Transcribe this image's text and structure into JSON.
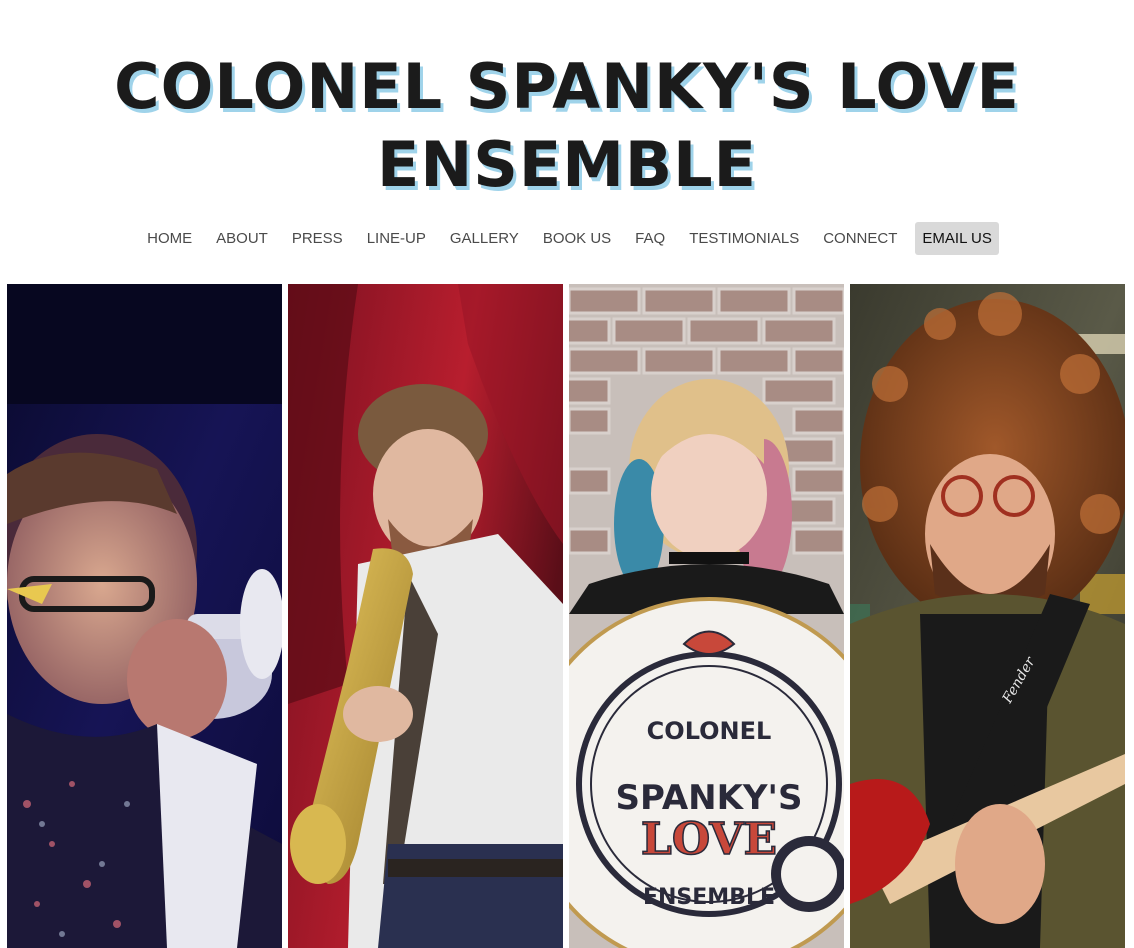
{
  "header": {
    "title_line1": "COLONEL SPANKY'S LOVE",
    "title_line2": "ENSEMBLE"
  },
  "nav": {
    "items": [
      {
        "label": "HOME"
      },
      {
        "label": "ABOUT"
      },
      {
        "label": "PRESS"
      },
      {
        "label": "LINE-UP"
      },
      {
        "label": "GALLERY"
      },
      {
        "label": "BOOK US"
      },
      {
        "label": "FAQ"
      },
      {
        "label": "TESTIMONIALS"
      },
      {
        "label": "CONNECT"
      }
    ],
    "cta_label": "EMAIL US"
  },
  "gallery": {
    "drum_logo": {
      "top": "COLONEL",
      "middle": "SPANKY'S",
      "love": "LOVE",
      "bottom": "ENSEMBLE"
    },
    "guitar_brand": "Fender"
  },
  "colors": {
    "title_shadow": "#9fd3ea",
    "nav_text": "#4a4a4a",
    "cta_bg": "#d9d9d9"
  }
}
